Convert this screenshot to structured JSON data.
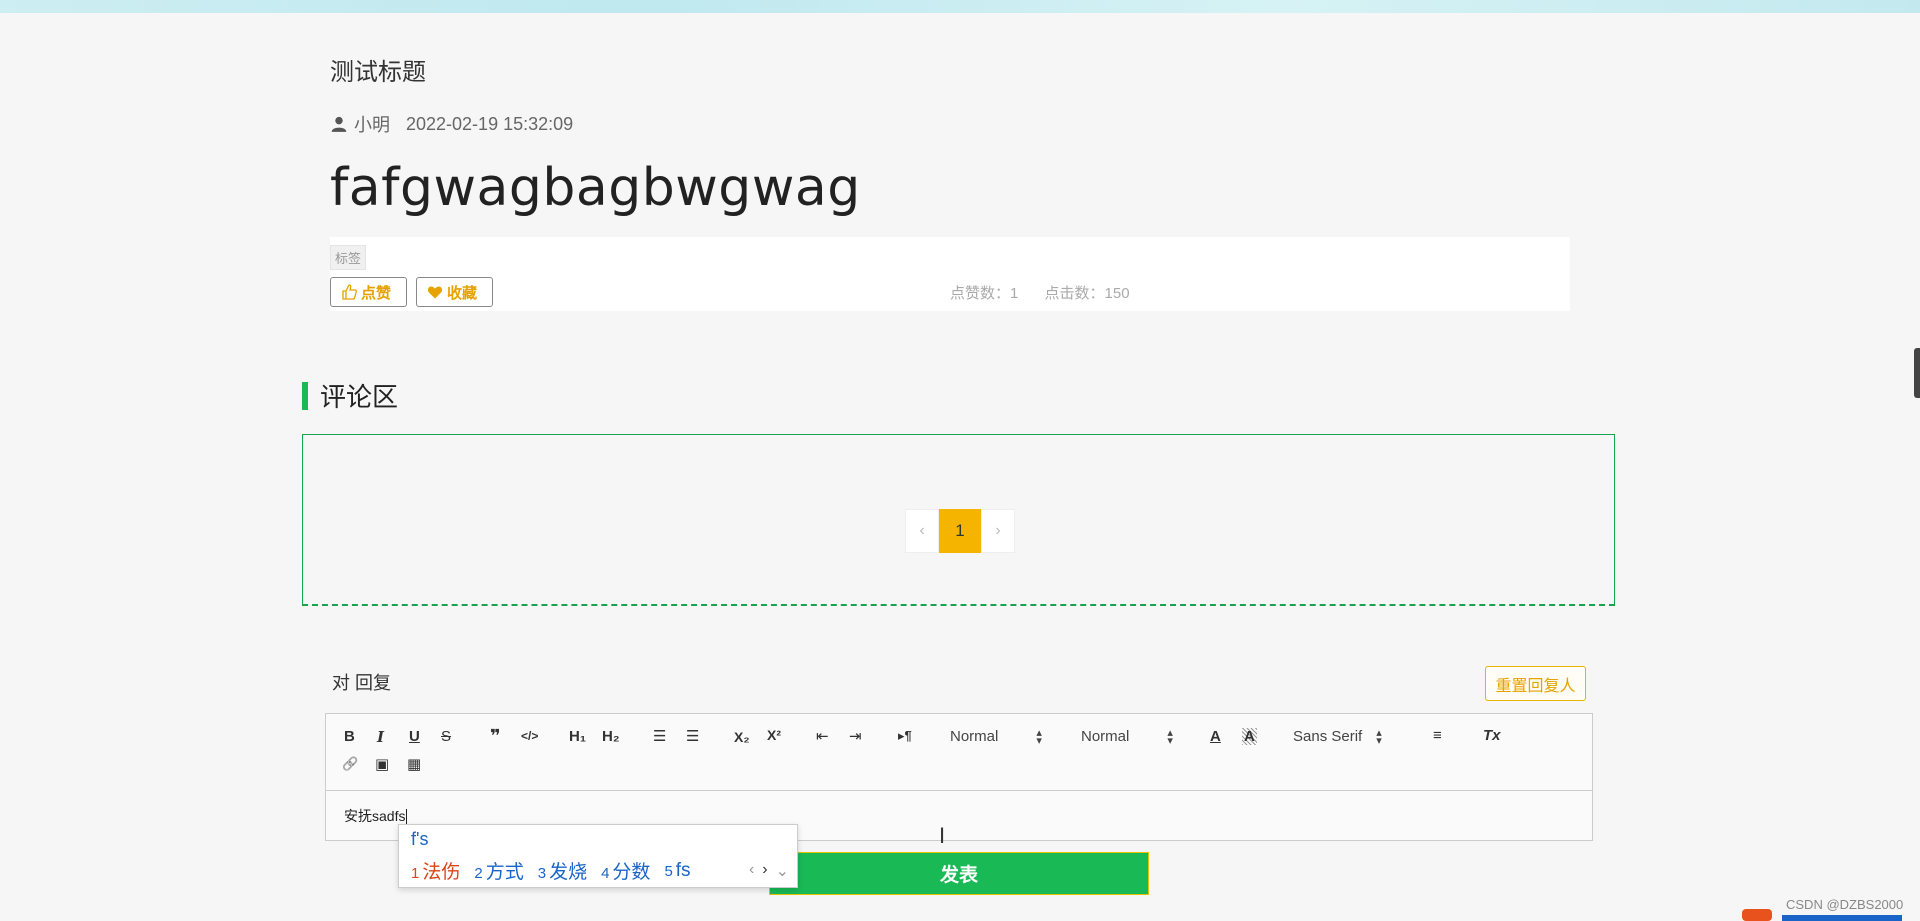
{
  "article": {
    "title": "测试标题",
    "author": "小明",
    "timestamp": "2022-02-19 15:32:09",
    "body": "fafgwagbagbwgwag",
    "tag": "标签",
    "like_label": "点赞",
    "favorite_label": "收藏",
    "likes_text": "点赞数：1",
    "clicks_text": "点击数：150"
  },
  "comments": {
    "section_title": "评论区",
    "pager": {
      "prev": "‹",
      "current": "1",
      "next": "›"
    }
  },
  "reply": {
    "label": "对 回复",
    "reset_label": "重置回复人",
    "submit_label": "发表",
    "content": "安抚sadfs"
  },
  "toolbar": {
    "bold": "B",
    "italic": "I",
    "underline": "U",
    "strike": "S",
    "quote": "❞",
    "code": "</>",
    "h1": "H₁",
    "h2": "H₂",
    "ordered_list": "☰",
    "bullet_list": "☰",
    "subscript": "X₂",
    "superscript": "X²",
    "outdent": "⇤",
    "indent": "⇥",
    "direction": "▸¶",
    "size_select": "Normal",
    "header_select": "Normal",
    "font_color": "A",
    "background": "A",
    "font_select": "Sans Serif",
    "align": "≡",
    "clean": "Tx",
    "link": "🔗",
    "image": "▣",
    "video": "▦"
  },
  "ime": {
    "input": "f's",
    "candidates": [
      {
        "num": "1",
        "text": "法伤"
      },
      {
        "num": "2",
        "text": "方式"
      },
      {
        "num": "3",
        "text": "发烧"
      },
      {
        "num": "4",
        "text": "分数"
      },
      {
        "num": "5",
        "text": "fs"
      }
    ]
  },
  "watermark": "CSDN @DZBS2000",
  "colors": {
    "accent_green": "#19b955",
    "accent_yellow": "#f5b400",
    "text_main": "#333333"
  }
}
